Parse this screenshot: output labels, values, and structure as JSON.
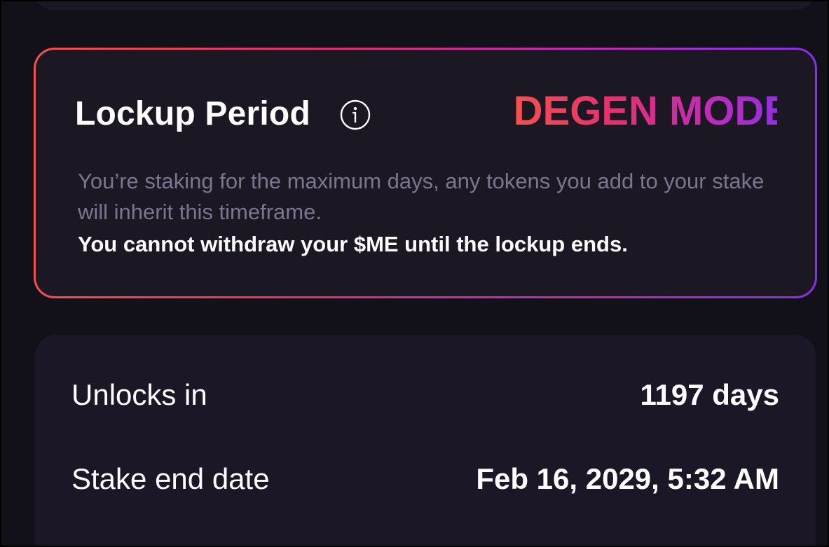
{
  "lockup": {
    "title": "Lockup Period",
    "badge": "DEGEN MODE",
    "description": "You’re staking for the maximum days, any tokens you add to your stake will inherit this timeframe.",
    "warning": "You cannot withdraw your $ME until the lockup ends."
  },
  "details": {
    "unlocks_label": "Unlocks in",
    "unlocks_value": "1197 days",
    "end_date_label": "Stake end date",
    "end_date_value": "Feb 16, 2029, 5:32 AM"
  },
  "colors": {
    "gradient_start": "#f4514f",
    "gradient_mid": "#e6316b",
    "gradient_end": "#8b2fe8",
    "card_bg": "#1b1824",
    "page_bg": "#121019"
  }
}
